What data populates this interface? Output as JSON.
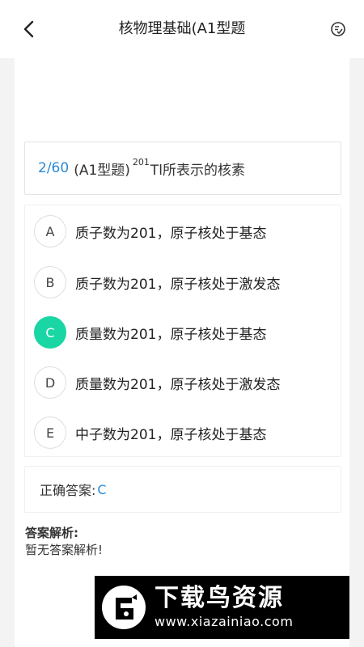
{
  "header": {
    "title": "核物理基础(A1型题",
    "back_icon": "chevron-left-icon",
    "action_icon": "check-list-icon"
  },
  "question": {
    "number": "2/60",
    "type": "(A1型题)",
    "superscript": "201",
    "text": "Tl所表示的核素"
  },
  "options": [
    {
      "letter": "A",
      "text": "质子数为201，原子核处于基态",
      "selected": false
    },
    {
      "letter": "B",
      "text": "质子数为201，原子核处于激发态",
      "selected": false
    },
    {
      "letter": "C",
      "text": "质量数为201，原子核处于基态",
      "selected": true
    },
    {
      "letter": "D",
      "text": "质量数为201，原子核处于激发态",
      "selected": false
    },
    {
      "letter": "E",
      "text": "中子数为201，原子核处于基态",
      "selected": false
    }
  ],
  "answer": {
    "label": "正确答案:",
    "value": "C"
  },
  "analysis": {
    "title": "答案解析:",
    "text": "暂无答案解析!"
  },
  "watermark": {
    "title": "下载鸟资源",
    "url": "www.xiazainiao.com"
  },
  "colors": {
    "accent_blue": "#2a8ad8",
    "selected_green": "#1ad6a4"
  }
}
